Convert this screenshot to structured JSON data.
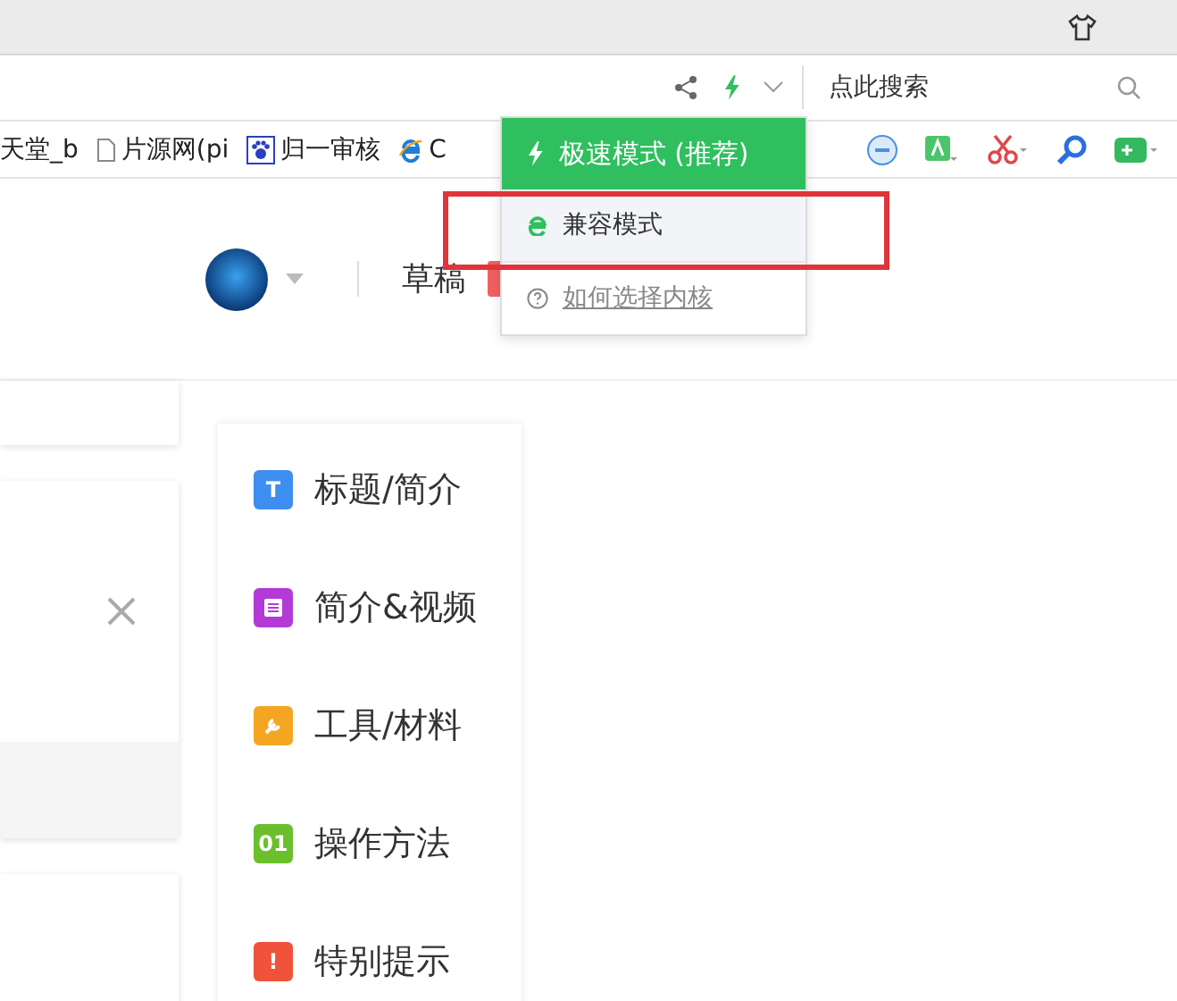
{
  "address_bar": {
    "search_placeholder": "点此搜索"
  },
  "bookmarks": [
    {
      "label": "天堂_b",
      "kind": "plain"
    },
    {
      "label": "片源网(pi",
      "kind": "page"
    },
    {
      "label": "归一审核",
      "kind": "paw"
    },
    {
      "label": "C",
      "kind": "ie"
    }
  ],
  "kernel_menu": {
    "items": [
      {
        "label": "极速模式 (推荐)",
        "kind": "speed",
        "selected": true
      },
      {
        "label": "兼容模式",
        "kind": "compat",
        "selected": false
      },
      {
        "label": "如何选择内核",
        "kind": "help",
        "selected": false
      }
    ]
  },
  "header": {
    "status": "草稿"
  },
  "outline": [
    {
      "label": "标题/简介",
      "kind": "text",
      "icon_text": "T",
      "color": "#3d8ef0"
    },
    {
      "label": "简介&视频",
      "kind": "list",
      "color": "#b33ad6"
    },
    {
      "label": "工具/材料",
      "kind": "wrench",
      "color": "#f4a623"
    },
    {
      "label": "操作方法",
      "kind": "text",
      "icon_text": "01",
      "color": "#6cbf2c"
    },
    {
      "label": "特别提示",
      "kind": "text",
      "icon_text": "!",
      "color": "#f0523a"
    }
  ]
}
